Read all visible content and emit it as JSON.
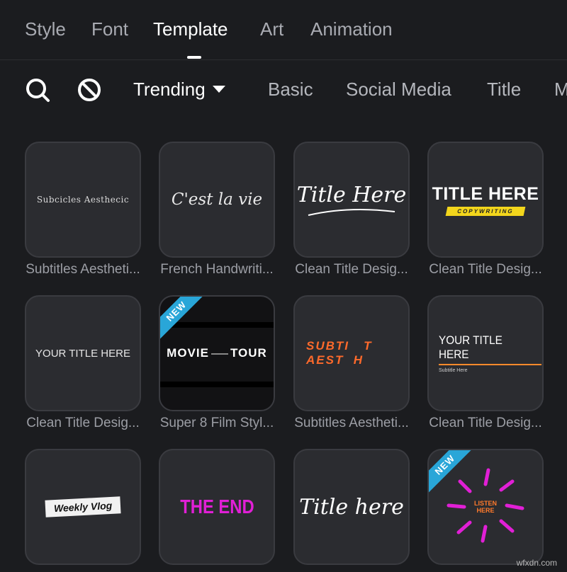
{
  "tabs": [
    "Style",
    "Font",
    "Template",
    "Art",
    "Animation"
  ],
  "active_tab": "Template",
  "filters": {
    "selected": "Trending",
    "chips": [
      "Basic",
      "Social Media",
      "Title",
      "M"
    ]
  },
  "templates": [
    {
      "caption": "Subtitles Aestheti...",
      "preview": "Subcicles Aesthecic"
    },
    {
      "caption": "French Handwriti...",
      "preview": "C'est la vie"
    },
    {
      "caption": "Clean Title Desig...",
      "preview": "Title Here"
    },
    {
      "caption": "Clean Title Desig...",
      "preview": "TITLE HERE",
      "sub": "COPYWRITING"
    },
    {
      "caption": "Clean Title Desig...",
      "preview": "YOUR TITLE HERE"
    },
    {
      "caption": "Super 8 Film Styl...",
      "preview_left": "MOVIE",
      "preview_right": "TOUR",
      "badge": "NEW"
    },
    {
      "caption": "Subtitles Aestheti...",
      "preview_l1": "SUBTI   T",
      "preview_l2": "AEST  H"
    },
    {
      "caption": "Clean Title Desig...",
      "preview": "YOUR TITLE HERE",
      "sub": "Subtitle Here"
    },
    {
      "caption": "",
      "preview": "Weekly Vlog"
    },
    {
      "caption": "",
      "preview": "THE END"
    },
    {
      "caption": "",
      "preview": "Title here"
    },
    {
      "caption": "",
      "preview": "LISTEN HERE",
      "badge": "NEW"
    }
  ],
  "watermark": "wfxdn.com",
  "colors": {
    "accent_badge": "#29a6d8",
    "yellow": "#f3d61c",
    "magenta": "#e11fd6",
    "orange": "#ff6a2b"
  }
}
